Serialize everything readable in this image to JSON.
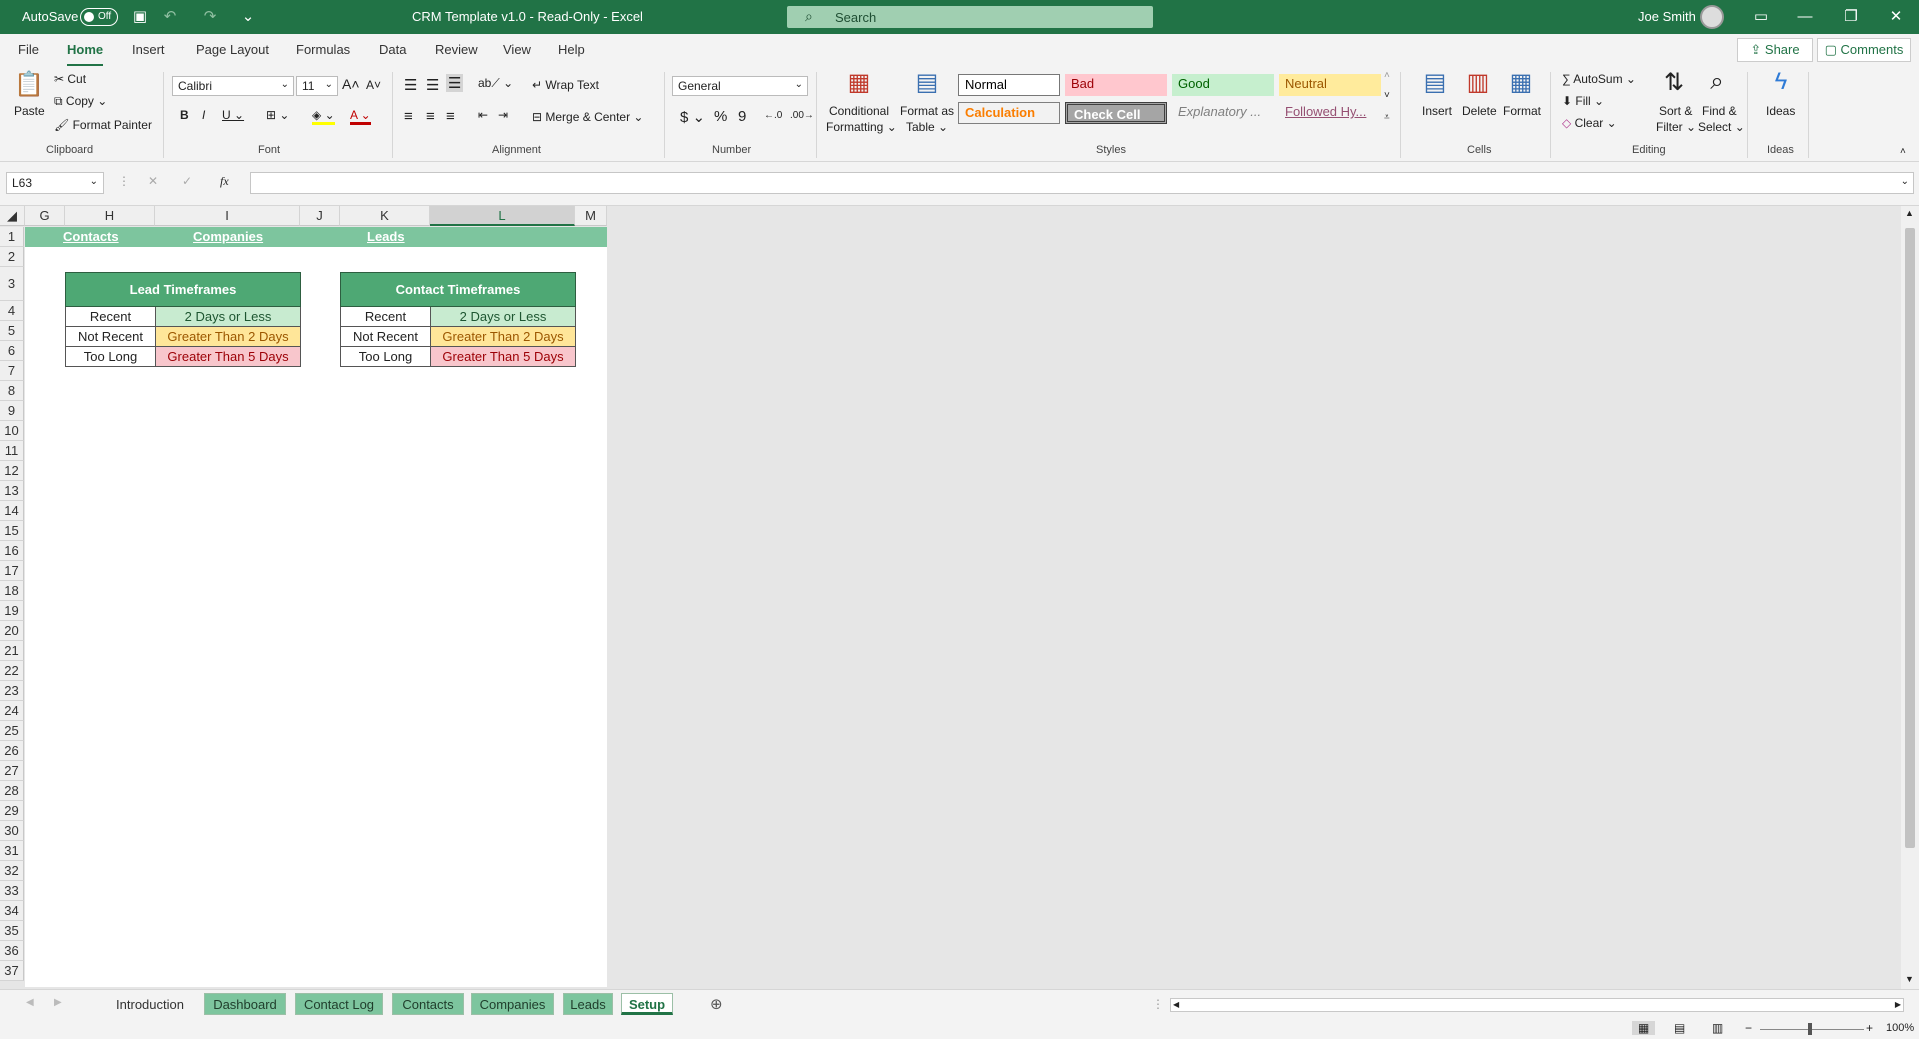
{
  "titlebar": {
    "autosave_label": "AutoSave",
    "autosave_state": "Off",
    "document_title": "CRM Template v1.0  -  Read-Only  -  Excel",
    "search_placeholder": "Search",
    "user_name": "Joe Smith"
  },
  "menu": {
    "items": [
      "File",
      "Home",
      "Insert",
      "Page Layout",
      "Formulas",
      "Data",
      "Review",
      "View",
      "Help"
    ],
    "share": "Share",
    "comments": "Comments"
  },
  "ribbon": {
    "clipboard": {
      "paste": "Paste",
      "cut": "Cut",
      "copy": "Copy",
      "format_painter": "Format Painter",
      "label": "Clipboard"
    },
    "font": {
      "name": "Calibri",
      "size": "11",
      "label": "Font"
    },
    "alignment": {
      "wrap_text": "Wrap Text",
      "merge_center": "Merge & Center",
      "label": "Alignment"
    },
    "number": {
      "format": "General",
      "label": "Number"
    },
    "styles": {
      "conditional_formatting": [
        "Conditional",
        "Formatting"
      ],
      "format_as_table": [
        "Format as",
        "Table"
      ],
      "cells": [
        "Normal",
        "Bad",
        "Good",
        "Neutral",
        "Calculation",
        "Check Cell",
        "Explanatory ...",
        "Followed Hy..."
      ],
      "label": "Styles"
    },
    "cells": {
      "insert": "Insert",
      "delete": "Delete",
      "format": "Format",
      "label": "Cells"
    },
    "editing": {
      "autosum": "AutoSum",
      "fill": "Fill",
      "clear": "Clear",
      "sort_filter": [
        "Sort &",
        "Filter"
      ],
      "find_select": [
        "Find &",
        "Select"
      ],
      "label": "Editing"
    },
    "ideas": {
      "button": "Ideas",
      "label": "Ideas"
    }
  },
  "formula_bar": {
    "name_box": "L63",
    "fx": "fx",
    "value": ""
  },
  "grid": {
    "columns": [
      "G",
      "H",
      "I",
      "J",
      "K",
      "L",
      "M"
    ],
    "selected_column": "L",
    "rows": [
      "1",
      "2",
      "3",
      "4",
      "5",
      "6",
      "7",
      "8",
      "9",
      "10",
      "11",
      "12",
      "13",
      "14",
      "15",
      "16",
      "17",
      "18",
      "19",
      "20",
      "21",
      "22",
      "23",
      "24",
      "25",
      "26",
      "27",
      "28",
      "29",
      "30",
      "31",
      "32",
      "33",
      "34",
      "35",
      "36",
      "37"
    ],
    "nav_links": [
      "Contacts",
      "Companies",
      "Leads"
    ]
  },
  "lead_timeframes": {
    "title": "Lead Timeframes",
    "rows": [
      {
        "label": "Recent",
        "value": "2 Days or Less"
      },
      {
        "label": "Not Recent",
        "value": "Greater Than 2 Days"
      },
      {
        "label": "Too Long",
        "value": "Greater Than 5 Days"
      }
    ]
  },
  "contact_timeframes": {
    "title": "Contact Timeframes",
    "rows": [
      {
        "label": "Recent",
        "value": "2 Days or Less"
      },
      {
        "label": "Not Recent",
        "value": "Greater Than 2 Days"
      },
      {
        "label": "Too Long",
        "value": "Greater Than 5 Days"
      }
    ]
  },
  "sheet_tabs": [
    "Introduction",
    "Dashboard",
    "Contact Log",
    "Contacts",
    "Companies",
    "Leads",
    "Setup"
  ],
  "active_sheet": "Setup",
  "status": {
    "zoom": "100%"
  }
}
